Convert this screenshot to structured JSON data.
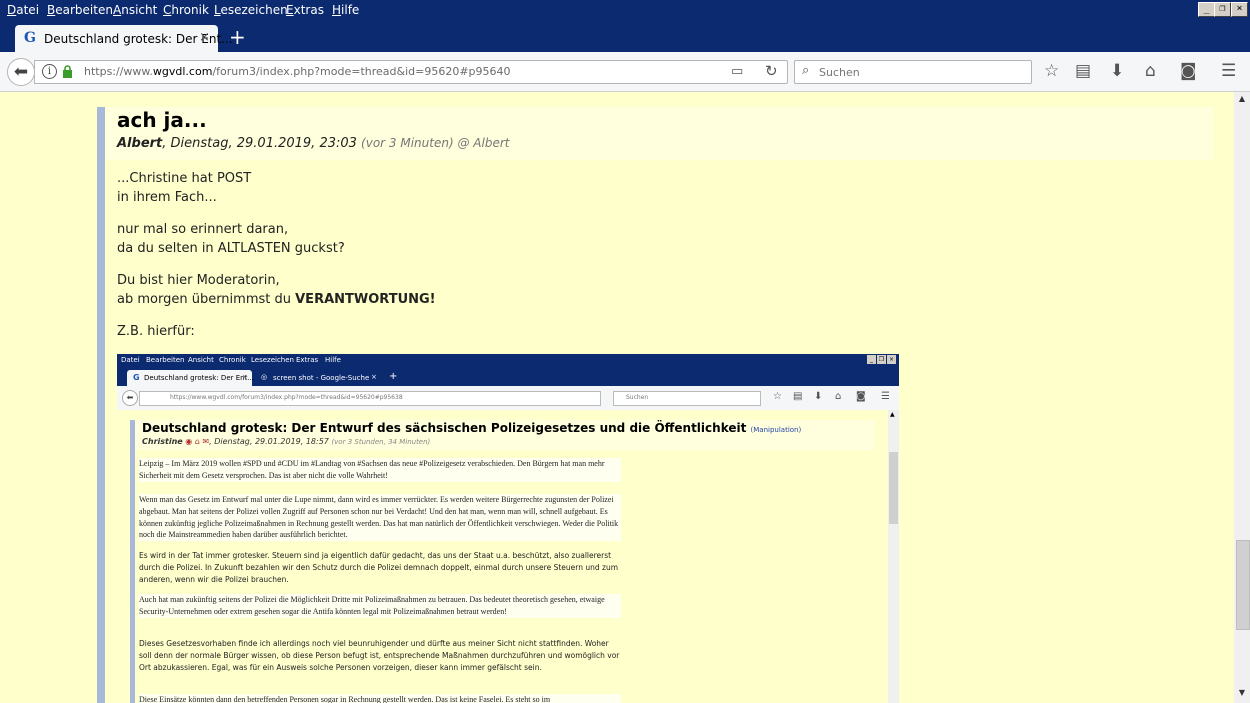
{
  "browser": {
    "menu": [
      "Datei",
      "Bearbeiten",
      "Ansicht",
      "Chronik",
      "Lesezeichen",
      "Extras",
      "Hilfe"
    ],
    "tab_title": "Deutschland grotesk: Der Ent...",
    "tab_close": "×",
    "new_tab": "+",
    "url_prefix": "https://www.",
    "url_domain": "wgvdl.com",
    "url_rest": "/forum3/index.php?mode=thread&id=95620#p95640",
    "search_placeholder": "Suchen"
  },
  "post": {
    "title": "ach ja...",
    "author": "Albert",
    "date": ", Dienstag, 29.01.2019, 23:03 ",
    "ago": "(vor 3 Minuten)",
    "reply_to": " @ Albert",
    "lines": [
      "...Christine hat POST",
      "in ihrem Fach...",
      "nur mal so erinnert daran,",
      "da du selten in ALTLASTEN guckst?",
      "Du bist hier Moderatorin,",
      "ab morgen übernimmst du ",
      "VERANTWORTUNG!",
      "Z.B. hierfür:"
    ]
  },
  "screenshot": {
    "menu": [
      "Datei",
      "Bearbeiten",
      "Ansicht",
      "Chronik",
      "Lesezeichen",
      "Extras",
      "Hilfe"
    ],
    "tab1": "Deutschland grotesk: Der Ent...",
    "tab2": "screen shot - Google-Suche",
    "url": "https://www.wgvdl.com/forum3/index.php?mode=thread&id=95620#p95638",
    "search": "Suchen",
    "title": "Deutschland grotesk: Der Entwurf des sächsischen Polizeigesetzes und die Öffentlichkeit",
    "tag": "(Manipulation)",
    "author": "Christine",
    "date": ", Dienstag, 29.01.2019, 18:57",
    "ago": "(vor 3 Stunden, 34 Minuten)",
    "paragraphs": [
      "Leipzig – Im März 2019 wollen #SPD und #CDU im #Landtag von #Sachsen das neue #Polizeigesetz verabschieden. Den Bürgern hat man mehr Sicherheit mit dem Gesetz versprochen. Das ist aber nicht die volle Wahrheit!",
      "Wenn man das Gesetz im Entwurf mal unter die Lupe nimmt, dann wird es immer verrückter. Es werden weitere Bürgerrechte zugunsten der Polizei abgebaut. Man hat seitens der Polizei vollen Zugriff auf Personen schon nur bei Verdacht! Und den hat man, wenn man will, schnell aufgebaut. Es können zukünftig jegliche Polizeimaßnahmen in Rechnung gestellt werden. Das hat man natürlich der Öffentlichkeit verschwiegen. Weder die Politik noch die Mainstreammedien haben darüber ausführlich berichtet.",
      "Es wird in der Tat immer grotesker. Steuern sind ja eigentlich dafür gedacht, das uns der Staat u.a. beschützt, also zuallererst durch die Polizei. In Zukunft bezahlen wir den Schutz durch die Polizei demnach doppelt, einmal durch unsere Steuern und zum anderen, wenn wir die Polizei brauchen.",
      "Auch hat man zukünftig seitens der Polizei die Möglichkeit Dritte mit Polizeimaßnahmen zu betrauen. Das bedeutet theoretisch gesehen, etwaige Security-Unternehmen oder extrem gesehen sogar die Antifa könnten legal mit Polizeimaßnahmen betraut werden!",
      "Dieses Gesetzesvorhaben finde ich allerdings noch viel beunruhigender und dürfte aus meiner Sicht nicht stattfinden. Woher soll denn der normale Bürger wissen, ob diese Person befugt ist, entsprechende Maßnahmen durchzuführen und womöglich vor Ort abzukassieren. Egal, was für ein Ausweis solche Personen vorzeigen, dieser kann immer gefälscht sein.",
      "Diese Einsätze könnten dann den betreffenden Personen sogar in Rechnung gestellt werden. Das ist keine Faselei. Es steht so im"
    ]
  }
}
